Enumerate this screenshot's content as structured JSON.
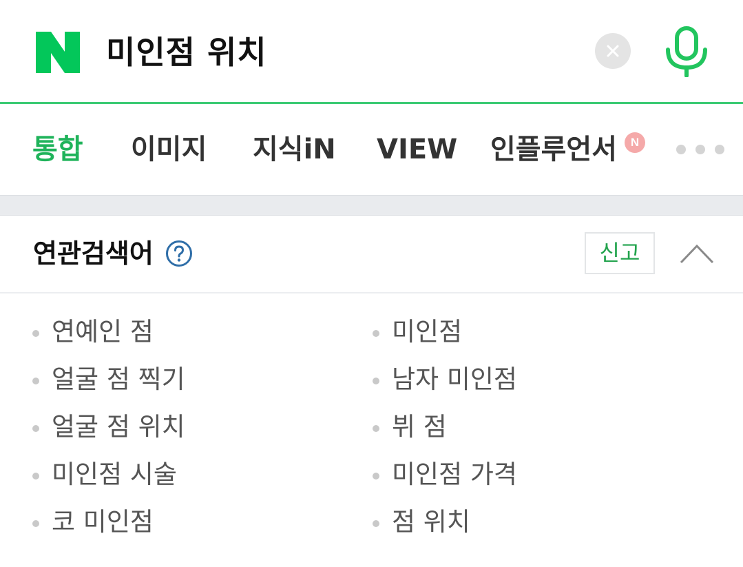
{
  "search": {
    "query": "미인점 위치",
    "logo_letter": "N"
  },
  "tabs": [
    {
      "label": "통합",
      "active": true
    },
    {
      "label": "이미지",
      "active": false
    },
    {
      "label": "지식iN",
      "active": false
    },
    {
      "label": "VIEW",
      "active": false
    },
    {
      "label": "인플루언서",
      "active": false,
      "badge": "N"
    }
  ],
  "related": {
    "title": "연관검색어",
    "report_label": "신고",
    "left_column": [
      "연예인 점",
      "얼굴 점 찍기",
      "얼굴 점 위치",
      "미인점 시술",
      "코 미인점"
    ],
    "right_column": [
      "미인점",
      "남자 미인점",
      "뷔 점",
      "미인점 가격",
      "점 위치"
    ]
  },
  "colors": {
    "brand_green": "#03c75a",
    "active_tab": "#1fb35a",
    "underline": "#3ccb74"
  },
  "icons": [
    "naver-logo",
    "clear-icon",
    "microphone-icon",
    "more-icon",
    "help-icon",
    "chevron-up-icon"
  ]
}
